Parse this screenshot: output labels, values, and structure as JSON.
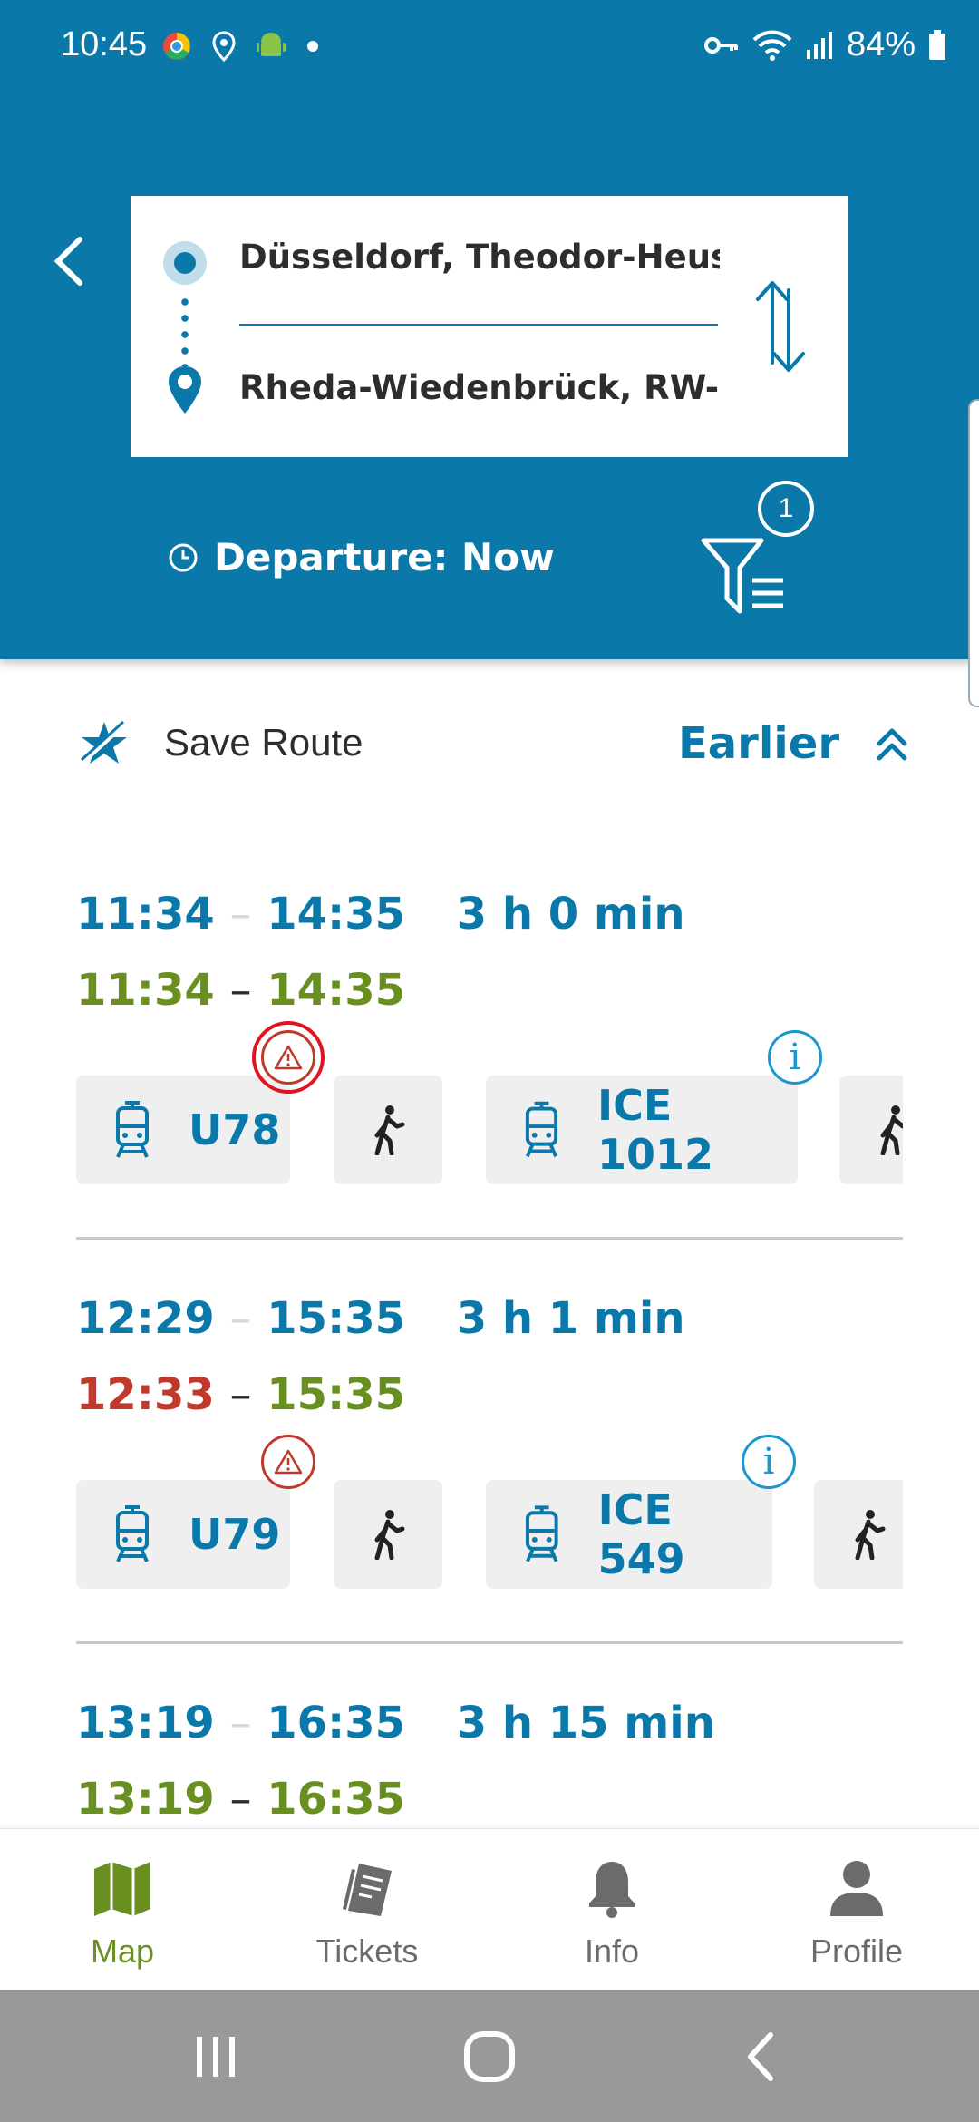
{
  "status_bar": {
    "time": "10:45",
    "battery": "84%"
  },
  "header": {
    "origin": "Düsseldorf, Theodor-Heuss-B",
    "destination": "Rheda-Wiedenbrück, RW-Rhe",
    "departure_label": "Departure: Now",
    "filter_count": "1"
  },
  "actions": {
    "save_route_label": "Save Route",
    "earlier_label": "Earlier"
  },
  "connections": [
    {
      "planned_dep": "11:34",
      "planned_arr": "14:35",
      "duration": "3 h 0 min",
      "realtime_dep": "11:34",
      "realtime_arr": "14:35",
      "realtime_dep_delayed": false,
      "legs": [
        {
          "type": "tram",
          "label": "U78",
          "warning": true
        },
        {
          "type": "walk"
        },
        {
          "type": "tram",
          "label": "ICE 1012",
          "info": true
        },
        {
          "type": "walk"
        }
      ]
    },
    {
      "planned_dep": "12:29",
      "planned_arr": "15:35",
      "duration": "3 h 1 min",
      "realtime_dep": "12:33",
      "realtime_arr": "15:35",
      "realtime_dep_delayed": true,
      "legs": [
        {
          "type": "tram",
          "label": "U79",
          "warning": true
        },
        {
          "type": "walk"
        },
        {
          "type": "tram",
          "label": "ICE 549",
          "info": true
        },
        {
          "type": "walk"
        }
      ]
    },
    {
      "planned_dep": "13:19",
      "planned_arr": "16:35",
      "duration": "3 h 15 min",
      "realtime_dep": "13:19",
      "realtime_arr": "16:35",
      "realtime_dep_delayed": false
    }
  ],
  "bottom_nav": [
    {
      "label": "Map",
      "icon": "map-icon",
      "active": true
    },
    {
      "label": "Tickets",
      "icon": "tickets-icon",
      "active": false
    },
    {
      "label": "Info",
      "icon": "bell-icon",
      "active": false
    },
    {
      "label": "Profile",
      "icon": "person-icon",
      "active": false
    }
  ],
  "colors": {
    "primary": "#0a79aa",
    "green": "#6a8f21",
    "red": "#c0392b",
    "info_blue": "#1b96cf"
  }
}
